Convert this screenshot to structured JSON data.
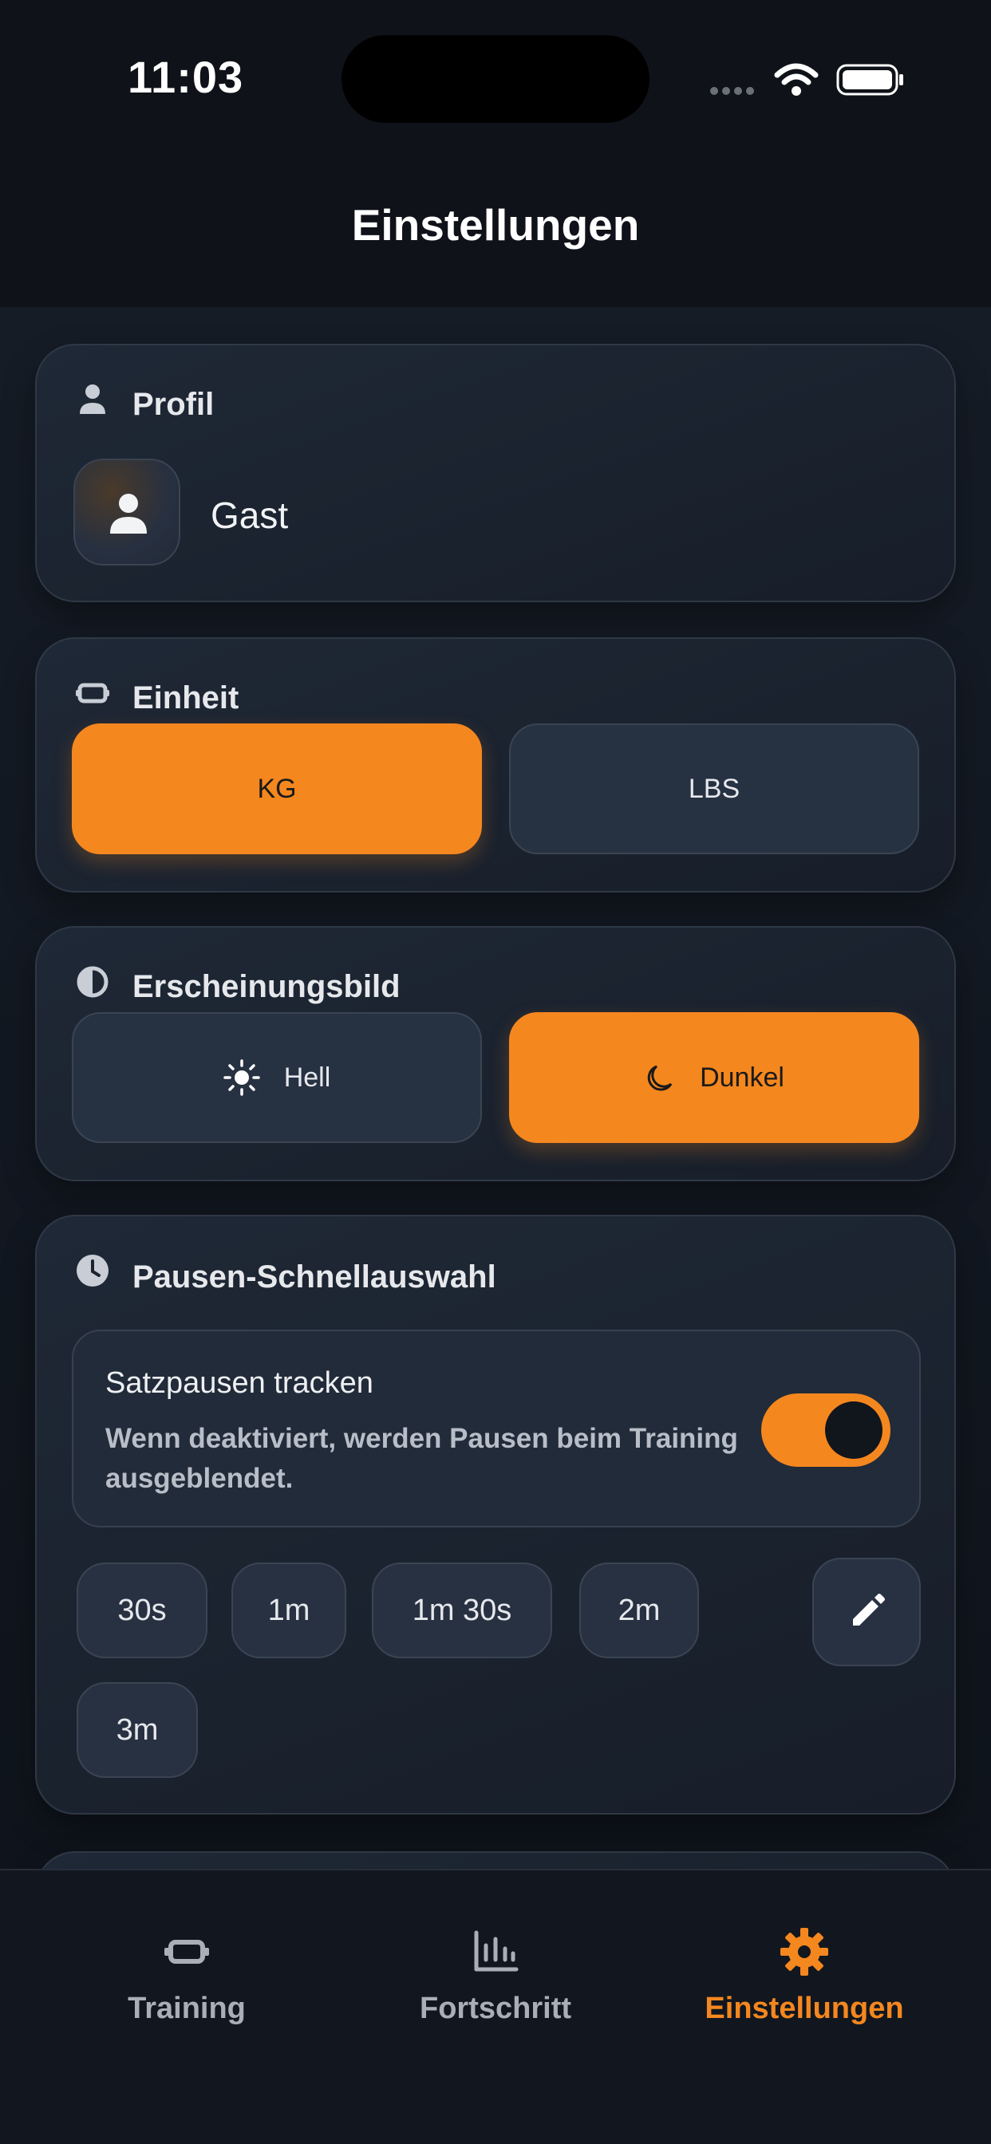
{
  "status_bar": {
    "time": "11:03"
  },
  "header": {
    "title": "Einstellungen"
  },
  "profile": {
    "title": "Profil",
    "name": "Gast"
  },
  "unit": {
    "title": "Einheit",
    "options": [
      "KG",
      "LBS"
    ],
    "selected": "KG"
  },
  "appearance": {
    "title": "Erscheinungsbild",
    "options": [
      "Hell",
      "Dunkel"
    ],
    "selected": "Dunkel"
  },
  "rest": {
    "title": "Pausen-Schnellauswahl",
    "toggle_title": "Satzpausen tracken",
    "toggle_description": "Wenn deaktiviert, werden Pausen beim Training ausgeblendet.",
    "toggle_on": true,
    "presets": [
      "30s",
      "1m",
      "1m 30s",
      "2m",
      "3m"
    ]
  },
  "tabbar": {
    "tabs": [
      "Training",
      "Fortschritt",
      "Einstellungen"
    ],
    "active": "Einstellungen"
  },
  "colors": {
    "accent": "#f5871f",
    "background": "#0f141c",
    "card": "#1f2836"
  }
}
